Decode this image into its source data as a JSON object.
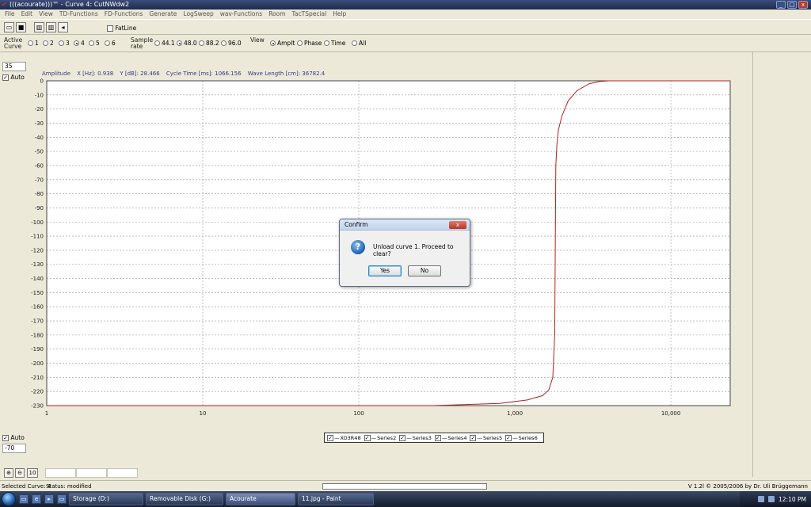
{
  "window": {
    "title": "(((acourate)))™ - Curve 4: CutNWdw2"
  },
  "menu": [
    "File",
    "Edit",
    "View",
    "TD-Functions",
    "FD-Functions",
    "Generate",
    "LogSweep",
    "wav-Functions",
    "Room",
    "TacTSpecial",
    "Help"
  ],
  "toolbar": {
    "fatline_label": "FatLine"
  },
  "options": {
    "active_curve_label": "Active Curve",
    "curves": [
      "1",
      "2",
      "3",
      "4",
      "5",
      "6"
    ],
    "selected_curve": "4",
    "sample_rate_label": "Sample rate",
    "sample_rates": [
      "44.1",
      "48.0",
      "88.2",
      "96.0"
    ],
    "selected_rate": "48.0",
    "view_label": "View",
    "views": [
      "Amplt",
      "Phase",
      "Time",
      "All"
    ],
    "selected_view": "Amplt"
  },
  "left": {
    "top_value": "35",
    "auto_label": "Auto",
    "bottom_value": "-70"
  },
  "info": {
    "amplitude": "Amplitude",
    "x": "X [Hz]: 0.938",
    "y": "Y [dB]: 28.466",
    "cycle": "Cycle Time [ms]: 1066.156",
    "wave": "Wave Length [cm]: 36782.4"
  },
  "chart_data": {
    "type": "line",
    "xscale": "log",
    "xlim": [
      1,
      24000
    ],
    "ylim": [
      -230,
      0
    ],
    "x_ticks": [
      1,
      10,
      100,
      1000,
      10000
    ],
    "x_tick_labels": [
      "1",
      "10",
      "100",
      "1,000",
      "10,000"
    ],
    "y_ticks": [
      0,
      -10,
      -20,
      -30,
      -40,
      -50,
      -60,
      -70,
      -80,
      -90,
      -100,
      -110,
      -120,
      -130,
      -140,
      -150,
      -160,
      -170,
      -180,
      -190,
      -200,
      -210,
      -220,
      -230
    ],
    "grid": true,
    "series": [
      {
        "name": "XO3R48",
        "color": "#b22222",
        "x": [
          1,
          300,
          800,
          1200,
          1500,
          1650,
          1750,
          1800,
          1830,
          1860,
          1900,
          2000,
          2200,
          2500,
          3000,
          3500,
          4000,
          24000
        ],
        "y": [
          -230,
          -230,
          -228.5,
          -226,
          -223,
          -219,
          -210,
          -180,
          -60,
          -45,
          -35,
          -25,
          -14,
          -7,
          -2,
          -0.5,
          0,
          0
        ]
      }
    ],
    "legend": [
      "XO3R48",
      "Series2",
      "Series3",
      "Series4",
      "Series5",
      "Series6"
    ],
    "legend_position": "bottom-center"
  },
  "dialog": {
    "title": "Confirm",
    "message": "Unload curve 1. Proceed to clear?",
    "yes": "Yes",
    "no": "No"
  },
  "zoom": {
    "ten_label": "10"
  },
  "status": {
    "selected": "Selected Curve: 4",
    "state": "Status: modified",
    "version": "V 1.2l © 2005/2006 by Dr. Uli Brüggemann"
  },
  "taskbar": {
    "tasks": [
      "Storage (D:)",
      "Removable Disk (G:)",
      "Acourate",
      "11.jpg - Paint"
    ],
    "clock": "12:10 PM"
  }
}
